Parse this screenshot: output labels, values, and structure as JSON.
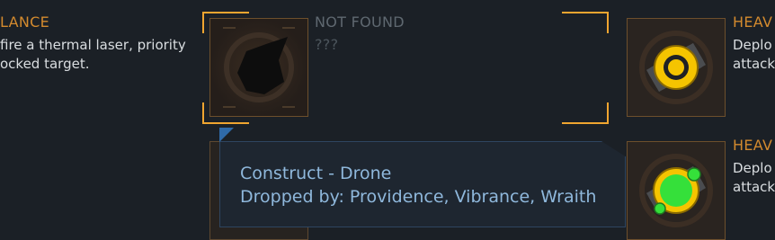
{
  "left_item": {
    "title": "LANCE",
    "desc_line1": "fire a thermal laser, priority",
    "desc_line2": "ocked target."
  },
  "selected_item": {
    "title": "NOT FOUND",
    "subtitle": "???"
  },
  "right_top_item": {
    "title": "HEAV",
    "desc_line1": "Deplo",
    "desc_line2": "attack"
  },
  "right_bottom_item": {
    "title": "HEAV",
    "desc_line1": "Deplo",
    "desc_line2": "attack"
  },
  "tooltip": {
    "line1": "Construct - Drone",
    "line2": "Dropped by: Providence, Vibrance, Wraith"
  },
  "colors": {
    "accent": "#f0a530",
    "title_orange": "#d38a2e",
    "tooltip_text": "#8fb8dc",
    "drone_yellow": "#f5c400",
    "drone_green": "#35e03a"
  },
  "icons": {
    "unknown": "unknown-item-icon",
    "yellow_drone": "yellow-drone-icon",
    "green_drone": "green-drone-icon"
  }
}
